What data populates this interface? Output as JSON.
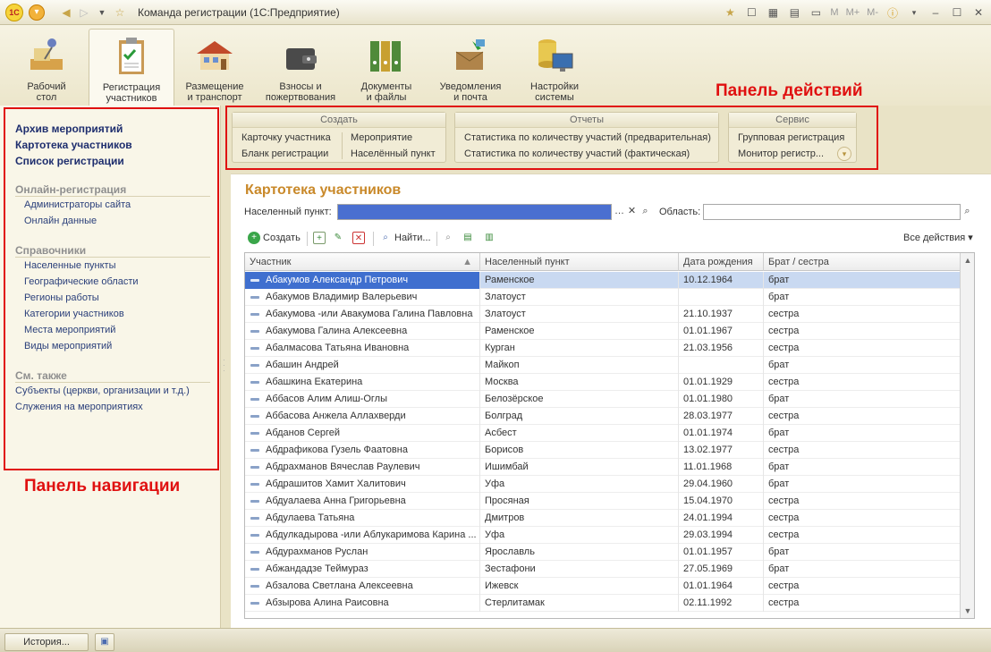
{
  "window": {
    "title": "Команда регистрации (1С:Предприятие)",
    "logo_text": "1C"
  },
  "titlebar_right": {
    "m": "M",
    "m_plus": "M+",
    "m_minus": "M-"
  },
  "sections": [
    {
      "label": "Рабочий\nстол",
      "line1": "Рабочий",
      "line2": "стол"
    },
    {
      "line1": "Регистрация",
      "line2": "участников"
    },
    {
      "line1": "Размещение",
      "line2": "и транспорт"
    },
    {
      "line1": "Взносы и",
      "line2": "пожертвования"
    },
    {
      "line1": "Документы",
      "line2": "и файлы"
    },
    {
      "line1": "Уведомления",
      "line2": "и почта"
    },
    {
      "line1": "Настройки",
      "line2": "системы"
    }
  ],
  "captions": {
    "actions": "Панель действий",
    "navigation": "Панель навигации"
  },
  "nav": {
    "main": [
      "Архив мероприятий",
      "Картотека участников",
      "Список регистрации"
    ],
    "online_title": "Онлайн-регистрация",
    "online": [
      "Администраторы сайта",
      "Онлайн данные"
    ],
    "refs_title": "Справочники",
    "refs": [
      "Населенные пункты",
      "Географические области",
      "Регионы работы",
      "Категории участников",
      "Места мероприятий",
      "Виды мероприятий"
    ],
    "see_title": "См. также",
    "see": [
      "Субъекты (церкви, организации и т.д.)",
      "Служения на мероприятиях"
    ]
  },
  "actions": {
    "create_title": "Создать",
    "create": [
      "Карточку участника",
      "Бланк регистрации",
      "Мероприятие",
      "Населённый пункт"
    ],
    "reports_title": "Отчеты",
    "reports": [
      "Статистика по количеству участий (предварительная)",
      "Статистика по количеству участий (фактическая)"
    ],
    "service_title": "Сервис",
    "service": [
      "Групповая регистрация",
      "Монитор регистр..."
    ]
  },
  "form": {
    "title": "Картотека участников",
    "locality_label": "Населенный пункт:",
    "region_label": "Область:",
    "locality_value": "",
    "region_value": "",
    "create_btn": "Создать",
    "find_btn": "Найти...",
    "all_actions": "Все действия ▾"
  },
  "table": {
    "columns": [
      "Участник",
      "Населенный пункт",
      "Дата рождения",
      "Брат / сестра"
    ],
    "rows": [
      [
        "Абакумов Александр Петрович",
        "Раменское",
        "10.12.1964",
        "брат"
      ],
      [
        "Абакумов Владимир Валерьевич",
        "Златоуст",
        "",
        "брат"
      ],
      [
        "Абакумова -или Авакумова Галина Павловна",
        "Златоуст",
        "21.10.1937",
        "сестра"
      ],
      [
        "Абакумова Галина Алексеевна",
        "Раменское",
        "01.01.1967",
        "сестра"
      ],
      [
        "Абалмасова Татьяна Ивановна",
        "Курган",
        "21.03.1956",
        "сестра"
      ],
      [
        "Абашин Андрей",
        "Майкоп",
        "",
        "брат"
      ],
      [
        "Абашкина Екатерина",
        "Москва",
        "01.01.1929",
        "сестра"
      ],
      [
        "Аббасов Алим Алиш-Оглы",
        "Белозёрское",
        "01.01.1980",
        "брат"
      ],
      [
        "Аббасова Анжела Аллахверди",
        "Болград",
        "28.03.1977",
        "сестра"
      ],
      [
        "Абданов Сергей",
        "Асбест",
        "01.01.1974",
        "брат"
      ],
      [
        "Абдрафикова Гузель Фаатовна",
        "Борисов",
        "13.02.1977",
        "сестра"
      ],
      [
        "Абдрахманов Вячеслав Раулевич",
        "Ишимбай",
        "11.01.1968",
        "брат"
      ],
      [
        "Абдрашитов Хамит Халитович",
        "Уфа",
        "29.04.1960",
        "брат"
      ],
      [
        "Абдуалаева Анна Григорьевна",
        "Просяная",
        "15.04.1970",
        "сестра"
      ],
      [
        "Абдулаева Татьяна",
        "Дмитров",
        "24.01.1994",
        "сестра"
      ],
      [
        "Абдулкадырова -или Аблукаримова Карина ...",
        "Уфа",
        "29.03.1994",
        "сестра"
      ],
      [
        "Абдурахманов Руслан",
        "Ярославль",
        "01.01.1957",
        "брат"
      ],
      [
        "Абжандадзе Теймураз",
        "Зестафони",
        "27.05.1969",
        "брат"
      ],
      [
        "Абзалова Светлана Алексеевна",
        "Ижевск",
        "01.01.1964",
        "сестра"
      ],
      [
        "Абзырова Алина Раисовна",
        "Стерлитамак",
        "02.11.1992",
        "сестра"
      ]
    ]
  },
  "statusbar": {
    "history": "История..."
  },
  "colors": {
    "accent_title": "#c9892a",
    "nav_link": "#1e2e6e",
    "frame_red": "#e01010",
    "selection": "#c9d9f1"
  }
}
